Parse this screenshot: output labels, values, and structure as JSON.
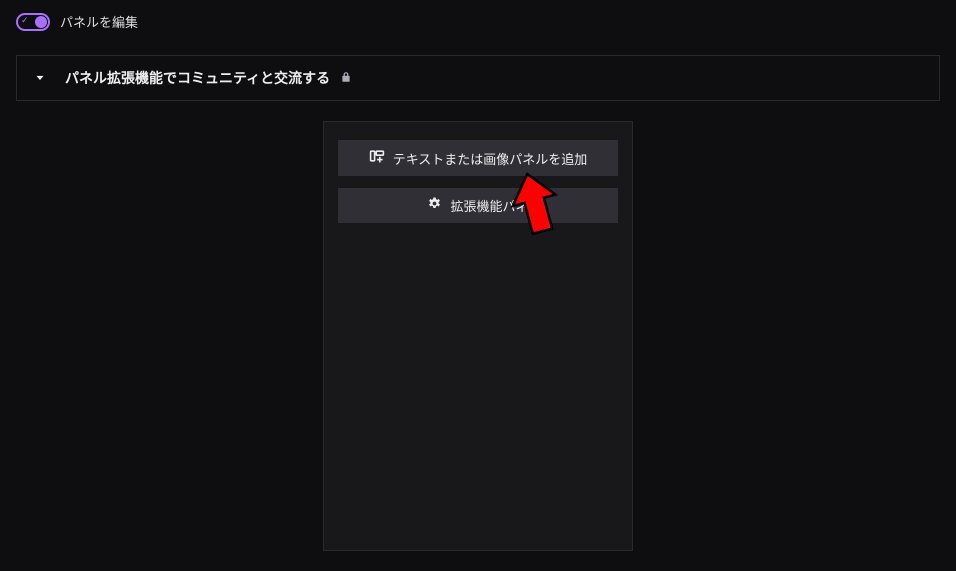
{
  "topbar": {
    "toggle_label": "パネルを編集"
  },
  "accordion": {
    "title": "パネル拡張機能でコミュニティと交流する"
  },
  "panel": {
    "add_text_image_label": "テキストまたは画像パネルを追加",
    "add_extension_label": "拡張機能パネ"
  }
}
